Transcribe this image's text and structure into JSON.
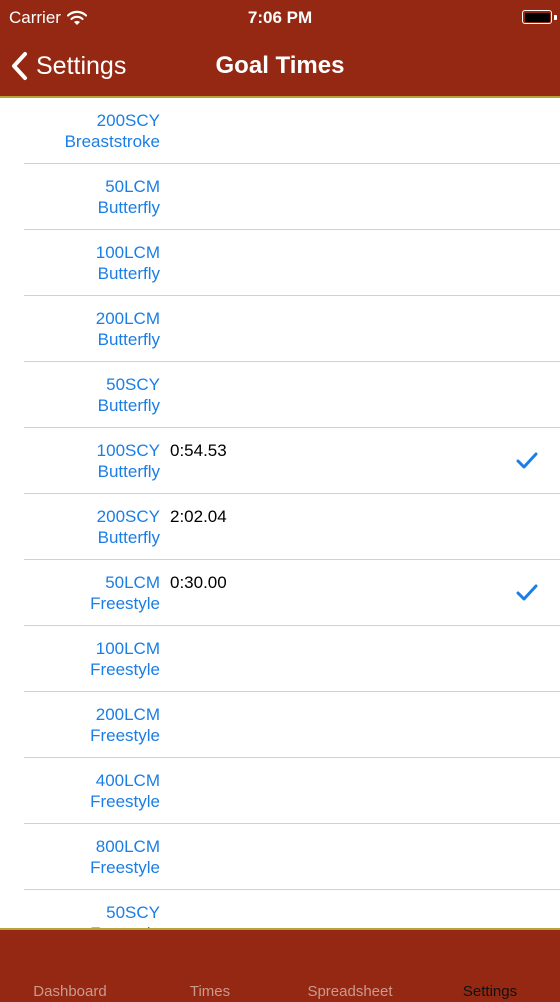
{
  "status_bar": {
    "carrier": "Carrier",
    "time": "7:06 PM"
  },
  "nav": {
    "back_label": "Settings",
    "title": "Goal Times"
  },
  "rows": [
    {
      "distance": "200SCY",
      "stroke": "Breaststroke",
      "time": "",
      "checked": false
    },
    {
      "distance": "50LCM",
      "stroke": "Butterfly",
      "time": "",
      "checked": false
    },
    {
      "distance": "100LCM",
      "stroke": "Butterfly",
      "time": "",
      "checked": false
    },
    {
      "distance": "200LCM",
      "stroke": "Butterfly",
      "time": "",
      "checked": false
    },
    {
      "distance": "50SCY",
      "stroke": "Butterfly",
      "time": "",
      "checked": false
    },
    {
      "distance": "100SCY",
      "stroke": "Butterfly",
      "time": "0:54.53",
      "checked": true
    },
    {
      "distance": "200SCY",
      "stroke": "Butterfly",
      "time": "2:02.04",
      "checked": false
    },
    {
      "distance": "50LCM",
      "stroke": "Freestyle",
      "time": "0:30.00",
      "checked": true
    },
    {
      "distance": "100LCM",
      "stroke": "Freestyle",
      "time": "",
      "checked": false
    },
    {
      "distance": "200LCM",
      "stroke": "Freestyle",
      "time": "",
      "checked": false
    },
    {
      "distance": "400LCM",
      "stroke": "Freestyle",
      "time": "",
      "checked": false
    },
    {
      "distance": "800LCM",
      "stroke": "Freestyle",
      "time": "",
      "checked": false
    },
    {
      "distance": "50SCY",
      "stroke": "Freestyle",
      "time": "",
      "checked": false
    }
  ],
  "tabs": [
    {
      "label": "Dashboard",
      "active": false
    },
    {
      "label": "Times",
      "active": false
    },
    {
      "label": "Spreadsheet",
      "active": false
    },
    {
      "label": "Settings",
      "active": true
    }
  ],
  "colors": {
    "bar": "#952812",
    "accent": "#1a7ee6",
    "tab_inactive": "#c99a8e",
    "tab_active": "#111111"
  }
}
